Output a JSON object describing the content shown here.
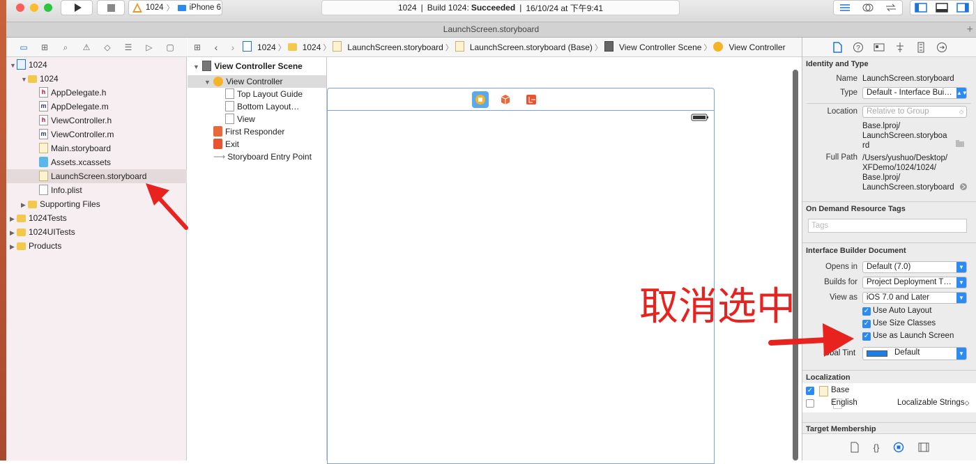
{
  "toolbar": {
    "scheme_target": "1024",
    "device": "iPhone 6",
    "activity_project": "1024",
    "activity_build": "Build 1024:",
    "activity_status": "Succeeded",
    "activity_time": "16/10/24 at 下午9:41"
  },
  "tab_title": "LaunchScreen.storyboard",
  "navigator": {
    "items": [
      {
        "label": "1024",
        "icon": "project-icon"
      },
      {
        "label": "1024",
        "icon": "folder-icon"
      },
      {
        "label": "AppDelegate.h",
        "icon": "h"
      },
      {
        "label": "AppDelegate.m",
        "icon": "m"
      },
      {
        "label": "ViewController.h",
        "icon": "h"
      },
      {
        "label": "ViewController.m",
        "icon": "m"
      },
      {
        "label": "Main.storyboard",
        "icon": "storyboard-icon"
      },
      {
        "label": "Assets.xcassets",
        "icon": "assets-icon"
      },
      {
        "label": "LaunchScreen.storyboard",
        "icon": "storyboard-icon"
      },
      {
        "label": "Info.plist",
        "icon": "plist-icon"
      },
      {
        "label": "Supporting Files",
        "icon": "folder-icon"
      },
      {
        "label": "1024Tests",
        "icon": "folder-icon"
      },
      {
        "label": "1024UITests",
        "icon": "folder-icon"
      },
      {
        "label": "Products",
        "icon": "folder-icon"
      }
    ]
  },
  "jumpbar": [
    "1024",
    "1024",
    "LaunchScreen.storyboard",
    "LaunchScreen.storyboard (Base)",
    "View Controller Scene",
    "View Controller"
  ],
  "outline": {
    "scene": "View Controller Scene",
    "items": [
      "View Controller",
      "Top Layout Guide",
      "Bottom Layout…",
      "View",
      "First Responder",
      "Exit",
      "Storyboard Entry Point"
    ]
  },
  "inspector": {
    "identity_title": "Identity and Type",
    "name_label": "Name",
    "name_value": "LaunchScreen.storyboard",
    "type_label": "Type",
    "type_value": "Default - Interface Bui…",
    "location_label": "Location",
    "location_value": "Relative to Group",
    "location_path_1": "Base.lproj/",
    "location_path_2": "LaunchScreen.storyboa",
    "location_path_3": "rd",
    "fullpath_label": "Full Path",
    "fullpath_1": "/Users/yushuo/Desktop/",
    "fullpath_2": "XFDemo/1024/1024/",
    "fullpath_3": "Base.lproj/",
    "fullpath_4": "LaunchScreen.storyboard",
    "ondemand_title": "On Demand Resource Tags",
    "tags_placeholder": "Tags",
    "ibdoc_title": "Interface Builder Document",
    "opens_label": "Opens in",
    "opens_value": "Default (7.0)",
    "builds_label": "Builds for",
    "builds_value": "Project Deployment T…",
    "viewas_label": "View as",
    "viewas_value": "iOS 7.0 and Later",
    "autolayout": "Use Auto Layout",
    "sizeclasses": "Use Size Classes",
    "launchscreen": "Use as Launch Screen",
    "tint_label": "lobal Tint",
    "tint_value": "Default",
    "tint_color": "#1a7fe6",
    "localization_title": "Localization",
    "loc_base": "Base",
    "loc_english": "English",
    "loc_english_value": "Localizable Strings",
    "target_title": "Target Membership"
  },
  "annotation": "取消选中",
  "colors": {
    "accent": "#2b8bf2",
    "annotation": "#e8231f"
  }
}
